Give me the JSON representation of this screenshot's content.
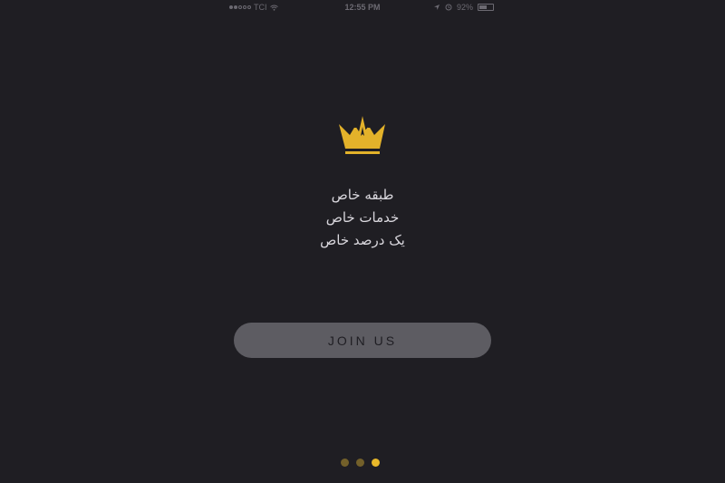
{
  "status_bar": {
    "carrier": "TCI",
    "time": "12:55 PM",
    "battery": "92%"
  },
  "icons": {
    "logo": "crown-icon",
    "wifi": "wifi-icon",
    "location": "location-icon",
    "alarm": "alarm-icon",
    "battery": "battery-icon"
  },
  "main": {
    "lines": [
      "طبقه خاص",
      "خدمات خاص",
      "یک درصد خاص"
    ],
    "join_label": "JOIN US"
  },
  "pager": {
    "total": 3,
    "active_index": 2
  },
  "colors": {
    "background": "#1f1e23",
    "accent": "#e8b82a",
    "accent_dim": "#73602a",
    "button": "#5d5c62",
    "text": "#d9d7dd"
  }
}
